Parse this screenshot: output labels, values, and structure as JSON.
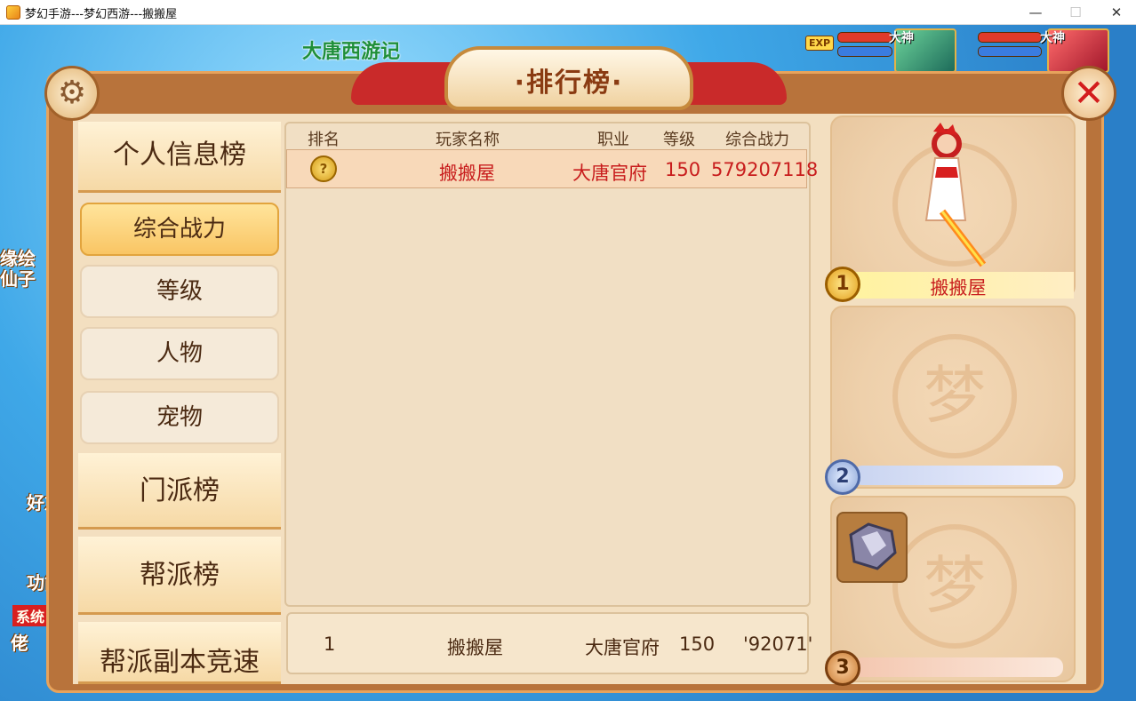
{
  "window": {
    "title": "梦幻手游---梦幻西游---搬搬屋",
    "min_symbol": "—",
    "max_symbol": "☐",
    "close_symbol": "✕"
  },
  "scene": {
    "quest_title": "大唐西游记",
    "left_texts": [
      "缘绘",
      "仙子"
    ],
    "friend_label": "好友",
    "feature_label": "功能",
    "system_tag": "系统",
    "chat_fragment": "佬",
    "exp_label": "EXP",
    "hero_tags": [
      "大神",
      "大神"
    ]
  },
  "panel": {
    "title": "·排行榜·",
    "settings_icon": "gear-icon",
    "close_icon": "close-icon"
  },
  "sidebar": {
    "sections": [
      {
        "label": "个人信息榜"
      },
      {
        "label": "门派榜"
      },
      {
        "label": "帮派榜"
      },
      {
        "label": "帮派副本竞速"
      }
    ],
    "subitems": [
      {
        "label": "综合战力",
        "active": true
      },
      {
        "label": "等级",
        "active": false
      },
      {
        "label": "人物",
        "active": false
      },
      {
        "label": "宠物",
        "active": false
      }
    ]
  },
  "table": {
    "headers": [
      "排名",
      "玩家名称",
      "职业",
      "等级",
      "综合战力"
    ],
    "rows": [
      {
        "rank_icon": "gold-medal-icon",
        "medal_glyph": "?",
        "name": "搬搬屋",
        "class": "大唐官府",
        "level": "150",
        "power": "579207118"
      }
    ],
    "my_row": {
      "rank": "1",
      "name": "搬搬屋",
      "class": "大唐官府",
      "level": "150",
      "power": "'92071'"
    }
  },
  "podium": {
    "first": {
      "rank": "1",
      "name": "搬搬屋"
    },
    "second": {
      "rank": "2",
      "name": ""
    },
    "third": {
      "rank": "3",
      "name": ""
    },
    "emblem_glyph": "梦"
  },
  "colors": {
    "accent_red": "#c81d1d",
    "panel_brown": "#b8733b",
    "tab_active": "#f9c564"
  }
}
